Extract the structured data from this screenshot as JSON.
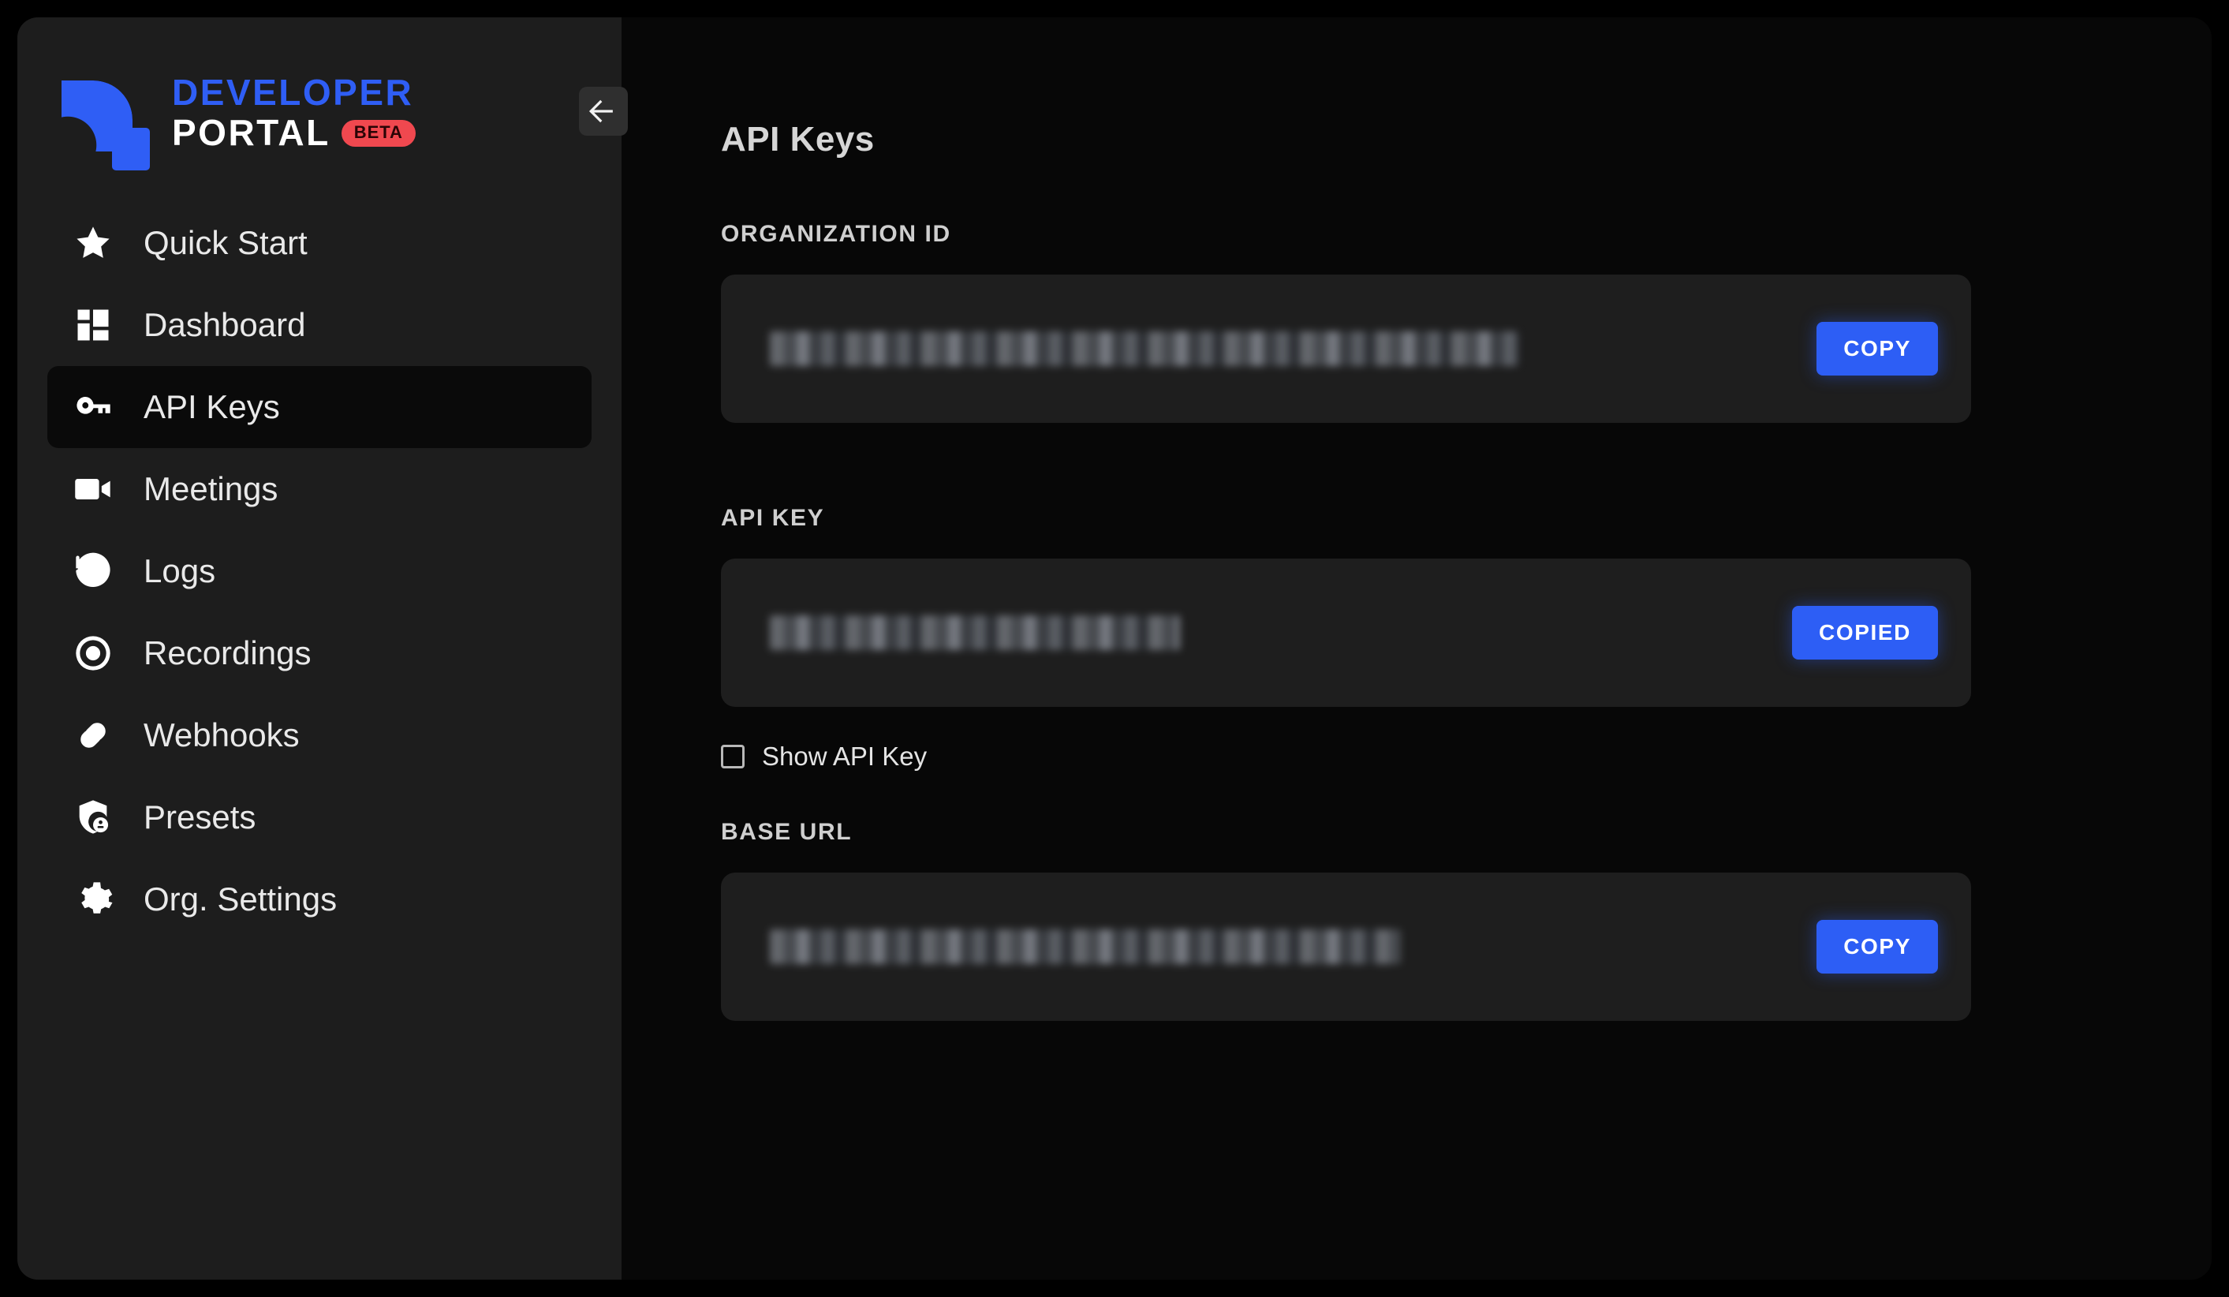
{
  "brand": {
    "line1": "DEVELOPER",
    "line2": "PORTAL",
    "badge": "BETA",
    "logo_color": "#2f5ef5",
    "badge_color": "#f0484f"
  },
  "sidebar": {
    "collapse_button_label": "←",
    "items": [
      {
        "label": "Quick Start",
        "icon": "star-icon",
        "active": false
      },
      {
        "label": "Dashboard",
        "icon": "grid-icon",
        "active": false
      },
      {
        "label": "API Keys",
        "icon": "key-icon",
        "active": true
      },
      {
        "label": "Meetings",
        "icon": "video-icon",
        "active": false
      },
      {
        "label": "Logs",
        "icon": "history-icon",
        "active": false
      },
      {
        "label": "Recordings",
        "icon": "record-icon",
        "active": false
      },
      {
        "label": "Webhooks",
        "icon": "link-icon",
        "active": false
      },
      {
        "label": "Presets",
        "icon": "shield-icon",
        "active": false
      },
      {
        "label": "Org. Settings",
        "icon": "gear-icon",
        "active": false
      }
    ]
  },
  "main": {
    "page_title": "API Keys",
    "accent_color": "#2d5ef5",
    "sections": {
      "organization_id": {
        "label": "ORGANIZATION ID",
        "value": "",
        "value_redacted": true,
        "copy_label": "COPY"
      },
      "api_key": {
        "label": "API KEY",
        "value": "",
        "value_redacted": true,
        "copy_label": "COPIED",
        "show_key_label": "Show API Key",
        "show_key_checked": false
      },
      "base_url": {
        "label": "BASE URL",
        "value": "",
        "value_redacted": true,
        "copy_label": "COPY"
      }
    }
  }
}
